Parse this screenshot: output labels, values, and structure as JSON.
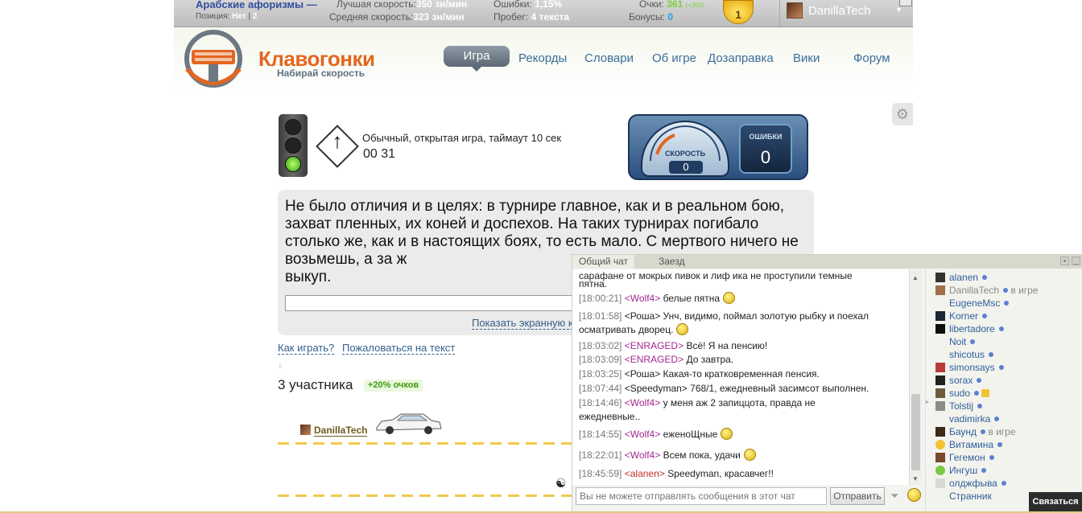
{
  "topbar": {
    "title": "Арабские афоризмы —",
    "position_label": "Позиция:",
    "position_value": "Нет",
    "position_sep": "|",
    "position_num": "2",
    "best_speed_label": "Лучшая скорость:",
    "best_speed_value": "350 зн/мин",
    "avg_speed_label": "Средняя скорость:",
    "avg_speed_value": "323 зн/мин",
    "errors_label": "Ошибки:",
    "errors_value": "1,15%",
    "mileage_label": "Пробег:",
    "mileage_value": "4 текста",
    "points_label": "Очки:",
    "points_value": "361",
    "points_bonus": "(+300)",
    "bonuses_label": "Бонусы:",
    "bonuses_value": "0",
    "level": "1",
    "username": "DanillaTech",
    "caret": "▼"
  },
  "header": {
    "logo_title": "Клавогонки",
    "logo_subtitle": "Набирай скорость",
    "nav": [
      "Игра",
      "Рекорды",
      "Словари",
      "Об игре",
      "Дозаправка",
      "Вики",
      "Форум"
    ]
  },
  "game": {
    "description": "Обычный, открытая игра, таймаут 10 сек",
    "timer": "00 31",
    "speed_label": "СКОРОСТЬ",
    "speed_value": "0",
    "errors_label": "ОШИБКИ",
    "errors_value": "0",
    "text": "Не было отличия и в целях: в турнире главное, как и в реальном бою, захват пленных, их коней и доспехов. На таких турнирах погибало столько же, как и в настоящих боях, то есть мало. С мертвого ничего не возьмешь, а за ж",
    "text_end": "выкуп.",
    "show_keyboard": "Показать экранную к",
    "how_to_play": "Как играть?",
    "complain": "Пожаловаться на текст",
    "participants": "3 участника",
    "bonus_badge": "+20% очков",
    "racer_name": "DanillaTech"
  },
  "chat": {
    "tab_general": "Общий чат",
    "tab_race": "Заезд",
    "partial_line_1": "сарафане от мокрых пивок и лиф ика не проступили темные",
    "partial_line_2": "пятна.",
    "messages": [
      {
        "ts": "[18:00:21]",
        "nick": "<Wolf4>",
        "text": "белые пятна",
        "smile": true
      },
      {
        "ts": "[18:01:58]",
        "nick": "<Роша>",
        "text": "Унч, видимо, поймал золотую рыбку и поехал",
        "text2": "осматривать дворец.",
        "smile": true
      },
      {
        "ts": "[18:03:02]",
        "nick": "<ENRAGED>",
        "text": "Всё! Я на пенсию!"
      },
      {
        "ts": "[18:03:09]",
        "nick": "<ENRAGED>",
        "text": "До завтра."
      },
      {
        "ts": "[18:03:25]",
        "nick": "<Роша>",
        "text": "Какая-то кратковременная пенсия."
      },
      {
        "ts": "[18:07:44]",
        "nick": "<Speedyman>",
        "text": "768/1, ежедневный засимсот выполнен."
      },
      {
        "ts": "[18:14:46]",
        "nick": "<Wolf4>",
        "text": "у меня аж 2 запиццота, правда не",
        "text2": "ежедневные.."
      },
      {
        "ts": "[18:14:55]",
        "nick": "<Wolf4>",
        "text": "еженоЩные",
        "smile": true
      },
      {
        "ts": "[18:22:01]",
        "nick": "<Wolf4>",
        "text": "Всем пока, удачи",
        "smile": true
      },
      {
        "ts": "[18:45:59]",
        "nick": "<alanen>",
        "text": "Speedyman, красавчег!!"
      }
    ],
    "input_placeholder": "Вы не можете отправлять сообщения в этот чат",
    "send_label": "Отправить",
    "users": [
      {
        "name": "alanen"
      },
      {
        "name": "DanillaTech",
        "status": "в игре",
        "self": true
      },
      {
        "name": "EugeneMsc"
      },
      {
        "name": "Korner"
      },
      {
        "name": "libertadore"
      },
      {
        "name": "Noit"
      },
      {
        "name": "shicotus"
      },
      {
        "name": "simonsays"
      },
      {
        "name": "sorax"
      },
      {
        "name": "sudo",
        "shield": true
      },
      {
        "name": "Tolstij"
      },
      {
        "name": "vadimirka"
      },
      {
        "name": "Баунд",
        "status": "в игре"
      },
      {
        "name": "Витамина"
      },
      {
        "name": "Гегемон"
      },
      {
        "name": "Ингуш"
      },
      {
        "name": "олджфыва"
      },
      {
        "name": "Странник"
      }
    ]
  },
  "contact_button": "Связаться",
  "colors": {
    "accent": "#e4661f",
    "link": "#335f8c",
    "nick": "#a3288f"
  }
}
